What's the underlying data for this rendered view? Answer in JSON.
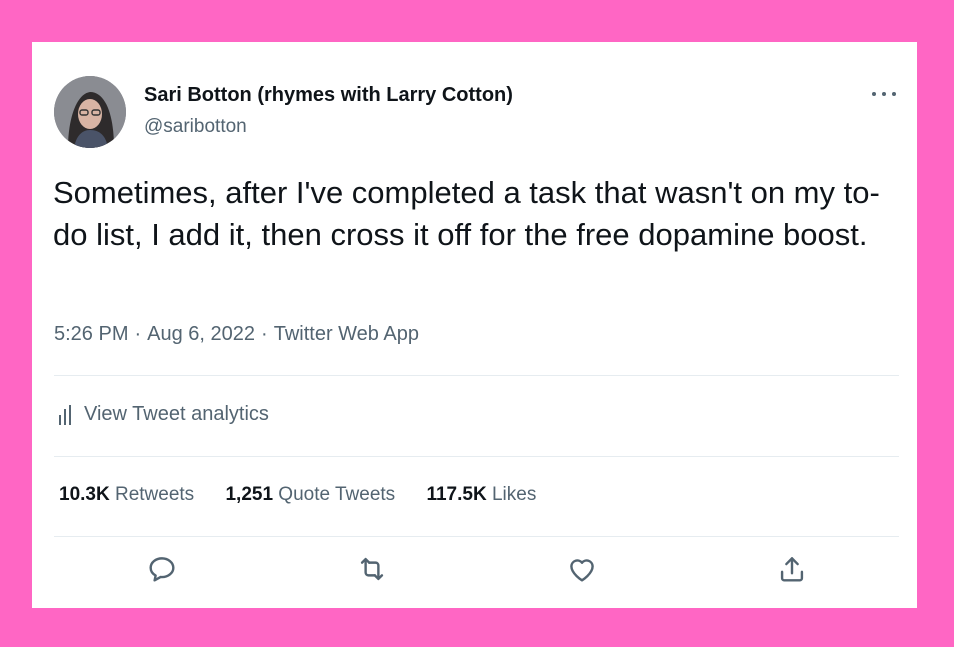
{
  "author": {
    "display_name": "Sari Botton (rhymes with Larry Cotton)",
    "handle": "@saribotton"
  },
  "tweet": {
    "text": "Sometimes, after I've completed a task that wasn't on my to-do list, I add it, then cross it off for the free dopamine boost.",
    "time": "5:26 PM",
    "date": "Aug 6, 2022",
    "source": "Twitter Web App",
    "separator": "·"
  },
  "analytics_label": "View Tweet analytics",
  "stats": {
    "retweets_count": "10.3K",
    "retweets_label": "Retweets",
    "quotes_count": "1,251",
    "quotes_label": "Quote Tweets",
    "likes_count": "117.5K",
    "likes_label": "Likes"
  },
  "icons": {
    "reply": "reply-icon",
    "retweet": "retweet-icon",
    "like": "heart-icon",
    "share": "share-icon",
    "more": "more-icon",
    "analytics": "analytics-icon"
  },
  "colors": {
    "background": "#ff66c4",
    "card": "#ffffff",
    "text_primary": "#0f1419",
    "text_secondary": "#536471"
  }
}
